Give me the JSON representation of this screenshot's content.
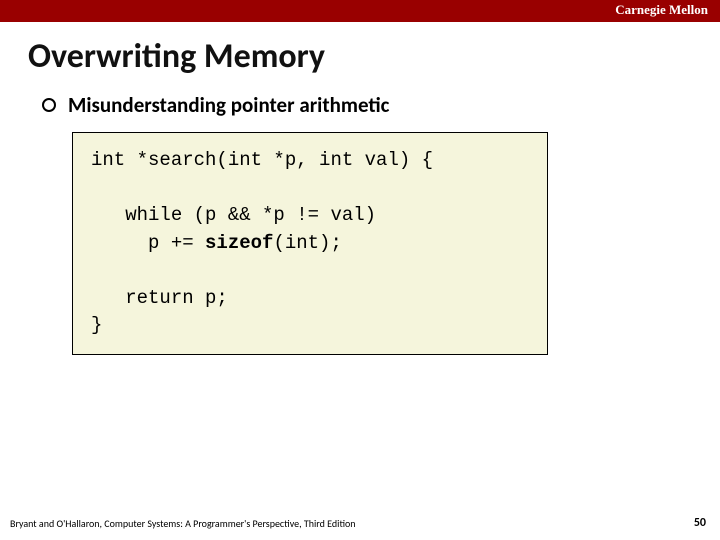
{
  "header": {
    "brand": "Carnegie Mellon"
  },
  "title": "Overwriting Memory",
  "bullet": {
    "text": "Misunderstanding pointer arithmetic"
  },
  "code": {
    "line1": "int *search(int *p, int val) {",
    "line2": "",
    "line3_a": "   while (p && *p != val)",
    "line4_a": "     p += ",
    "line4_kw": "sizeof",
    "line4_b": "(int);",
    "line5": "",
    "line6": "   return p;",
    "line7": "}"
  },
  "footer": {
    "left": "Bryant and O'Hallaron, Computer Systems: A Programmer's Perspective, Third Edition",
    "page": "50"
  }
}
